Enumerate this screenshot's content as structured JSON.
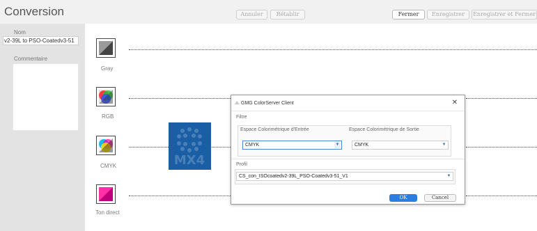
{
  "app": {
    "title": "Conversion"
  },
  "toolbar": {
    "undo_label": "Annuler",
    "redo_label": "Rétablir",
    "close_label": "Fermer",
    "save_label": "Enregistrer",
    "save_close_label": "Enregistrer et Fermer"
  },
  "left_panel": {
    "name_label": "Nom",
    "name_value": "v2-39L to PSO-Coatedv3-51",
    "comment_label": "Commentaire",
    "comment_value": ""
  },
  "colors": [
    {
      "label": "Gray",
      "icon": "gray-swatch-icon"
    },
    {
      "label": "RGB",
      "icon": "rgb-swatch-icon"
    },
    {
      "label": "CMYK",
      "icon": "cmyk-swatch-icon"
    },
    {
      "label": "Ton direct",
      "icon": "spot-color-swatch-icon"
    }
  ],
  "logo": {
    "text": "MX4"
  },
  "dialog": {
    "title": "GMG ColorServer Client",
    "filter_label": "Filtre",
    "input_space_label": "Espace Colorimétrique d'Entrée",
    "input_space_value": "CMYK",
    "output_space_label": "Espace Colorimétrique de Sortie",
    "output_space_value": "CMYK",
    "profile_label": "Profil",
    "profile_value": "CS_con_ISOcoatedv2-39L_PSO-Coatedv3-51_V1",
    "ok_label": "OK",
    "cancel_label": "Cancel"
  },
  "accent_color": "#2a7de1"
}
